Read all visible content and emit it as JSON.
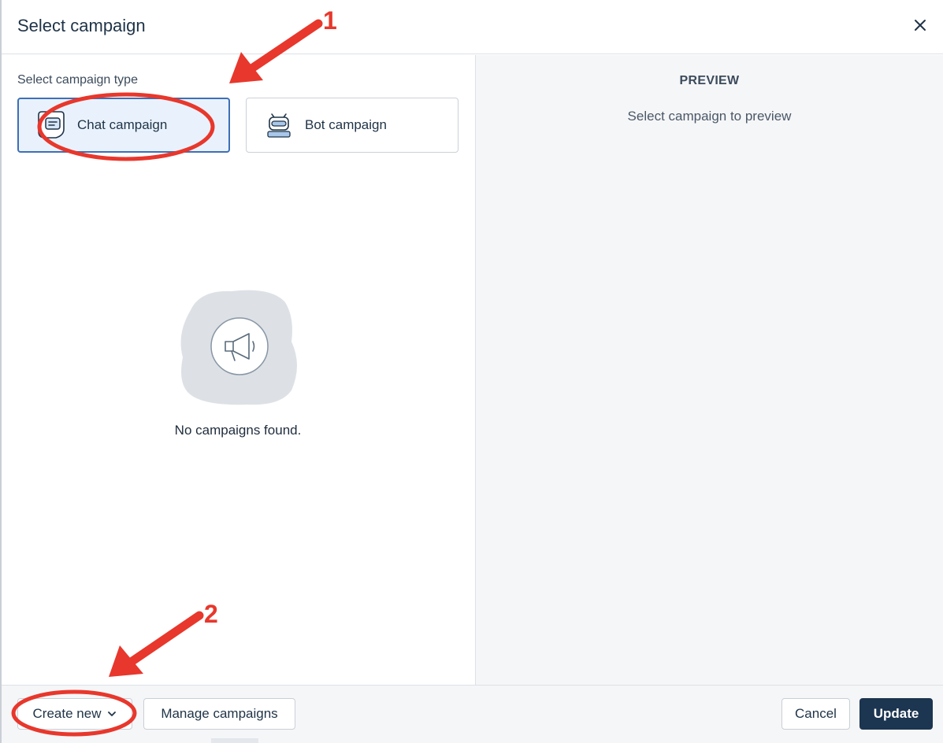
{
  "dialog": {
    "title": "Select campaign",
    "close_icon": "close-icon"
  },
  "left": {
    "type_label": "Select campaign type",
    "types": [
      {
        "label": "Chat campaign",
        "icon": "chat-bubble-icon",
        "selected": true
      },
      {
        "label": "Bot campaign",
        "icon": "robot-icon",
        "selected": false
      }
    ],
    "empty_state": {
      "icon": "megaphone-icon",
      "text": "No campaigns found."
    }
  },
  "preview": {
    "title": "PREVIEW",
    "subtitle": "Select campaign to preview"
  },
  "footer": {
    "create_new": "Create new",
    "manage": "Manage campaigns",
    "cancel": "Cancel",
    "update": "Update"
  },
  "annotations": {
    "step1": "1",
    "step2": "2",
    "color": "#e8372c"
  },
  "colors": {
    "primary": "#1c3550",
    "selected_border": "#3d6fb6",
    "selected_bg": "#e9f2fc"
  }
}
